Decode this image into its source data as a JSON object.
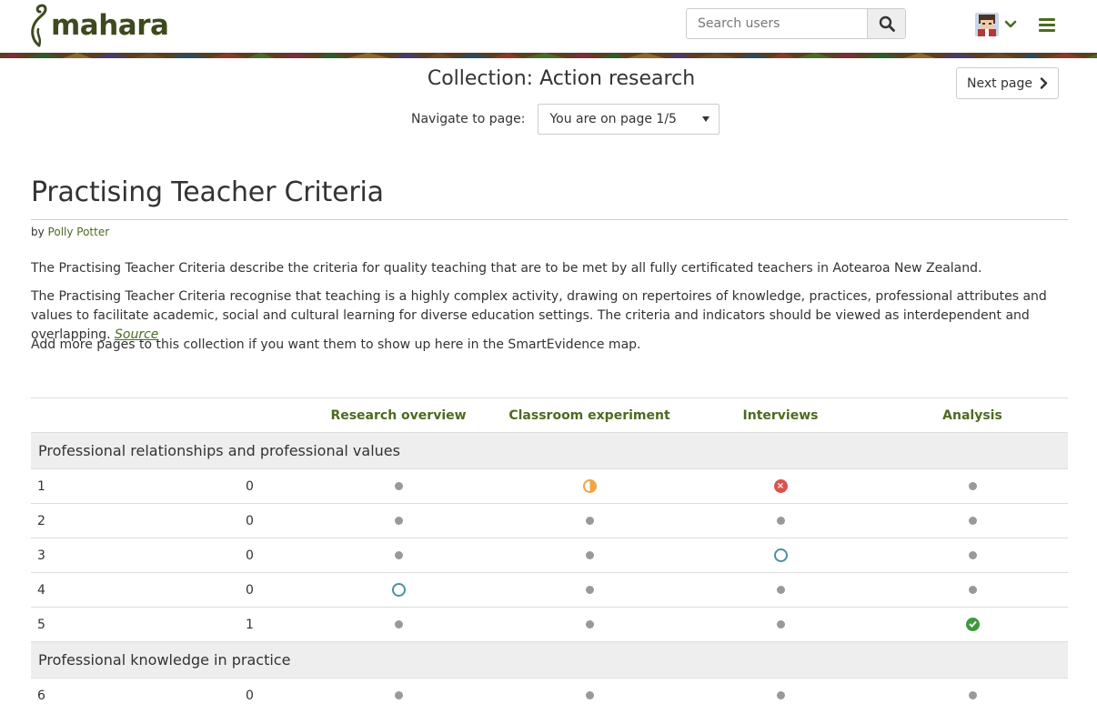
{
  "header": {
    "logo_text": "mahara",
    "search_placeholder": "Search users"
  },
  "collection": {
    "title": "Collection: Action research",
    "next_page_label": "Next page",
    "navigate_label": "Navigate to page:",
    "page_select_value": "You are on page 1/5"
  },
  "page": {
    "title": "Practising Teacher Criteria",
    "by_prefix": "by",
    "author": "Polly Potter",
    "para1": "The Practising Teacher Criteria describe the criteria for quality teaching that are to be met by all fully certificated teachers in Aotearoa New Zealand.",
    "para2": "The Practising Teacher Criteria recognise that teaching is a highly complex activity, drawing on repertoires of knowledge, practices, professional attributes and values to facilitate academic, social and cultural learning for diverse education settings. The criteria and indicators should be viewed as interdependent and overlapping.",
    "source_link": "Source",
    "para3": "Add more pages to this collection if you want them to show up here in the SmartEvidence map."
  },
  "matrix": {
    "columns": [
      "Research overview",
      "Classroom experiment",
      "Interviews",
      "Analysis"
    ],
    "section1": "Professional relationships and professional values",
    "section2": "Professional knowledge in practice",
    "rows": [
      {
        "num": "1",
        "count": "0",
        "status": [
          "dot",
          "partial",
          "not-met",
          "dot"
        ]
      },
      {
        "num": "2",
        "count": "0",
        "status": [
          "dot",
          "dot",
          "dot",
          "dot"
        ]
      },
      {
        "num": "3",
        "count": "0",
        "status": [
          "dot",
          "dot",
          "ready",
          "dot"
        ]
      },
      {
        "num": "4",
        "count": "0",
        "status": [
          "ready",
          "dot",
          "dot",
          "dot"
        ]
      },
      {
        "num": "5",
        "count": "1",
        "status": [
          "dot",
          "dot",
          "dot",
          "met"
        ]
      },
      {
        "num": "6",
        "count": "0",
        "status": [
          "dot",
          "dot",
          "dot",
          "dot"
        ]
      }
    ]
  },
  "colors": {
    "brand": "#3d4a1f",
    "link": "#4e6a21",
    "ready": "#4e8ea3",
    "partial": "#f0a640",
    "not_met": "#d9534f",
    "met": "#3c9a3c"
  },
  "icons": {
    "search": "search-icon",
    "chevron": "chevron-down-icon",
    "menu": "hamburger-icon",
    "next": "chevron-right-icon",
    "select": "caret-down-icon"
  }
}
